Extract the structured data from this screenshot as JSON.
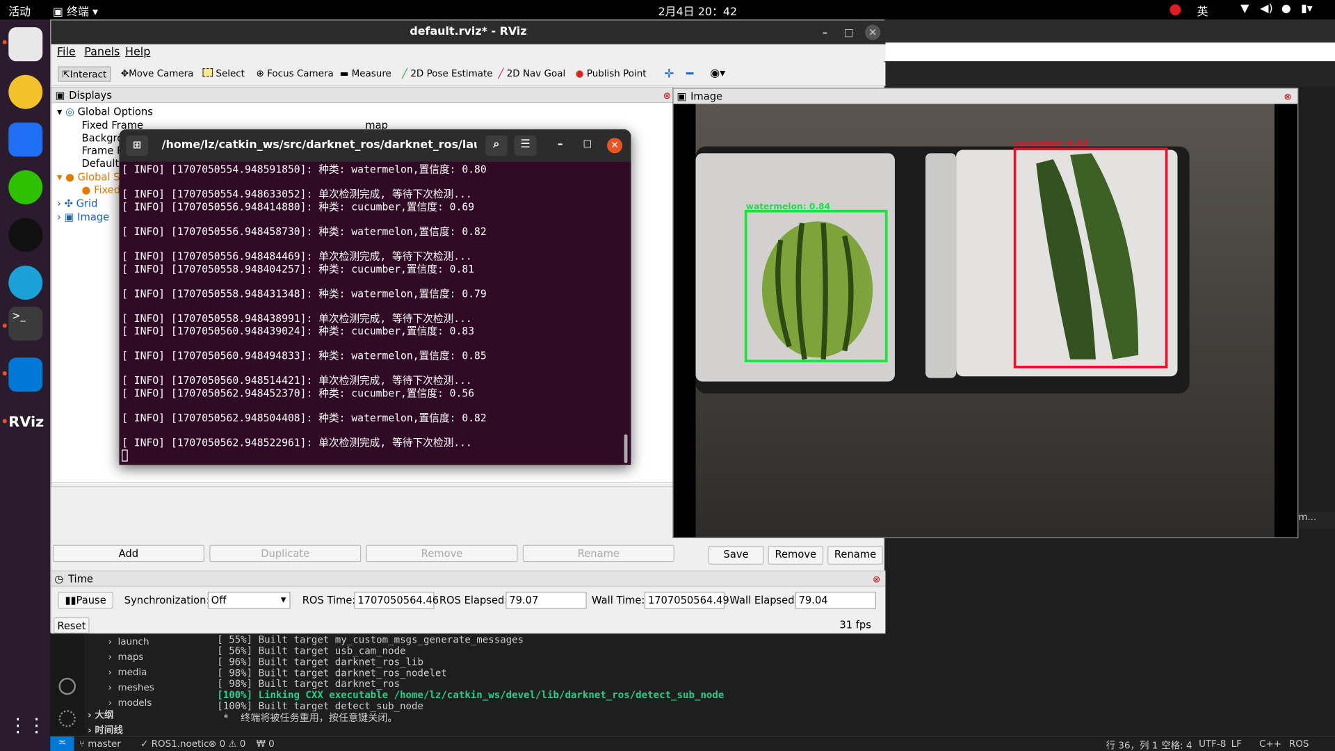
{
  "topbar": {
    "activities": "活动",
    "app_menu": "终端",
    "clock": "2月4日 20：42",
    "input_method": "英"
  },
  "dock": {
    "items": [
      "files-icon",
      "rhythmbox-icon",
      "feishu-icon",
      "wechat-icon",
      "qq-icon",
      "edge-icon",
      "terminal-icon",
      "vscode-icon",
      "rviz-icon",
      "app-grid-icon"
    ]
  },
  "rviz": {
    "title": "default.rviz* - RViz",
    "menu": [
      "File",
      "Panels",
      "Help"
    ],
    "toolbar": [
      "Interact",
      "Move Camera",
      "Select",
      "Focus Camera",
      "Measure",
      "2D Pose Estimate",
      "2D Nav Goal",
      "Publish Point"
    ],
    "displays": {
      "header": "Displays",
      "global_options": "Global Options",
      "fixed_frame_label": "Fixed Frame",
      "fixed_frame_value": "map",
      "background_label": "Backgro",
      "frame_rate_label": "Frame R",
      "default_label": "Default",
      "global_status": "Global S",
      "fixed_status": "Fixed",
      "grid": "Grid",
      "image": "Image"
    },
    "buttons": {
      "add": "Add",
      "duplicate": "Duplicate",
      "remove": "Remove",
      "rename": "Rename"
    },
    "view_buttons": {
      "save": "Save",
      "remove": "Remove",
      "rename": "Rename"
    },
    "image_panel": {
      "header": "Image",
      "detections": [
        {
          "label": "watermelon: 0.84",
          "color": "#22e040"
        },
        {
          "label": "cucumber: 0.60",
          "color": "#e8102a"
        }
      ]
    },
    "time": {
      "header": "Time",
      "pause": "Pause",
      "sync_label": "Synchronization:",
      "sync_value": "Off",
      "ros_time_label": "ROS Time:",
      "ros_time": "1707050564.46",
      "ros_elapsed_label": "ROS Elapsed:",
      "ros_elapsed": "79.07",
      "wall_time_label": "Wall Time:",
      "wall_time": "1707050564.49",
      "wall_elapsed_label": "Wall Elapsed:",
      "wall_elapsed": "79.04",
      "reset": "Reset",
      "fps": "31 fps"
    }
  },
  "terminal": {
    "title": "/home/lz/catkin_ws/src/darknet_ros/darknet_ros/launch/tes...",
    "lines": [
      "[ INFO] [1707050554.948591850]: 种类: watermelon,置信度: 0.80",
      "",
      "[ INFO] [1707050554.948633052]: 单次检测完成, 等待下次检测...",
      "[ INFO] [1707050556.948414880]: 种类: cucumber,置信度: 0.69",
      "",
      "[ INFO] [1707050556.948458730]: 种类: watermelon,置信度: 0.82",
      "",
      "[ INFO] [1707050556.948484469]: 单次检测完成, 等待下次检测...",
      "[ INFO] [1707050558.948404257]: 种类: cucumber,置信度: 0.81",
      "",
      "[ INFO] [1707050558.948431348]: 种类: watermelon,置信度: 0.79",
      "",
      "[ INFO] [1707050558.948438991]: 单次检测完成, 等待下次检测...",
      "[ INFO] [1707050560.948439024]: 种类: cucumber,置信度: 0.83",
      "",
      "[ INFO] [1707050560.948494833]: 种类: watermelon,置信度: 0.85",
      "",
      "[ INFO] [1707050560.948514421]: 单次检测完成, 等待下次检测...",
      "[ INFO] [1707050562.948452370]: 种类: cucumber,置信度: 0.56",
      "",
      "[ INFO] [1707050562.948504408]: 种类: watermelon,置信度: 0.82",
      "",
      "[ INFO] [1707050562.948522961]: 单次检测完成, 等待下次检测..."
    ]
  },
  "vscode": {
    "explorer": [
      "launch",
      "maps",
      "media",
      "meshes",
      "models"
    ],
    "outline": "大纲",
    "timeline": "时间线",
    "build_lines": [
      "[ 55%] Built target my_custom_msgs_generate_messages",
      "[ 56%] Built target usb_cam_node",
      "[ 96%] Built target darknet_ros_lib",
      "[ 98%] Built target darknet_ros_nodelet",
      "[ 98%] Built target darknet_ros",
      "[100%] Linking CXX executable /home/lz/catkin_ws/devel/lib/darknet_ros/detect_sub_node",
      "[100%] Built target detect_sub_node",
      " *  终端将被任务重用，按任意键关闭。"
    ],
    "status": {
      "branch": "master",
      "ros": "ROS1.noetic",
      "problems": "⊗ 0 ⚠ 0",
      "ports": "₩ 0",
      "position": "行 36，列 1",
      "spaces": "空格: 4",
      "encoding": "UTF-8",
      "eol": "LF",
      "lang": "C++",
      "ros_ext": "ROS",
      "side_tab": "m..."
    }
  }
}
